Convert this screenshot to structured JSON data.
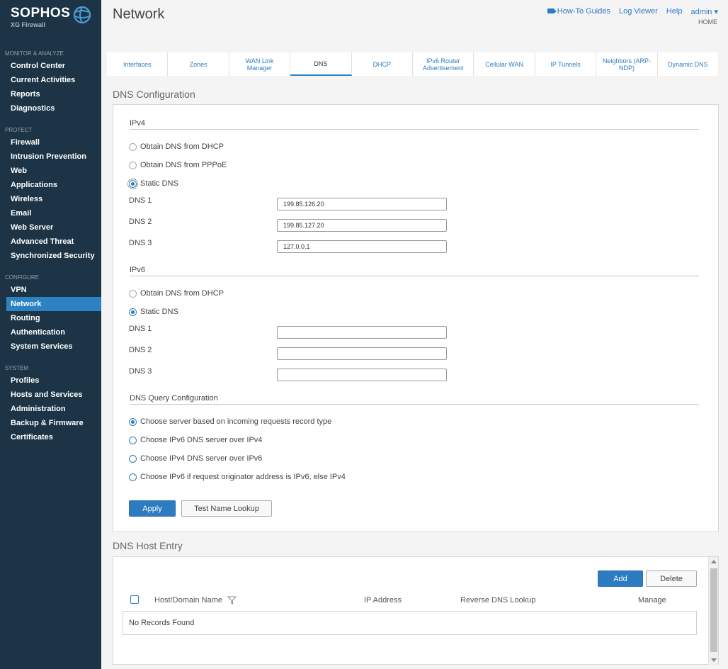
{
  "brand": {
    "name": "SOPHOS",
    "product": "XG Firewall"
  },
  "sidebar": {
    "sections": [
      {
        "label": "MONITOR & ANALYZE",
        "items": [
          "Control Center",
          "Current Activities",
          "Reports",
          "Diagnostics"
        ]
      },
      {
        "label": "PROTECT",
        "items": [
          "Firewall",
          "Intrusion Prevention",
          "Web",
          "Applications",
          "Wireless",
          "Email",
          "Web Server",
          "Advanced Threat",
          "Synchronized Security"
        ]
      },
      {
        "label": "CONFIGURE",
        "items": [
          "VPN",
          "Network",
          "Routing",
          "Authentication",
          "System Services"
        ]
      },
      {
        "label": "SYSTEM",
        "items": [
          "Profiles",
          "Hosts and Services",
          "Administration",
          "Backup & Firmware",
          "Certificates"
        ]
      }
    ],
    "active": "Network"
  },
  "header": {
    "title": "Network",
    "links": {
      "howto": "How-To Guides",
      "log": "Log Viewer",
      "help": "Help",
      "user": "admin ▾"
    },
    "home": "HOME"
  },
  "tabs": [
    "Interfaces",
    "Zones",
    "WAN Link Manager",
    "DNS",
    "DHCP",
    "IPv6 Router Advertisement",
    "Cellular WAN",
    "IP Tunnels",
    "Neighbors (ARP-NDP)",
    "Dynamic DNS"
  ],
  "active_tab": "DNS",
  "dns_config": {
    "title": "DNS Configuration",
    "ipv4": {
      "label": "IPv4",
      "options": [
        "Obtain DNS from DHCP",
        "Obtain DNS from PPPoE",
        "Static DNS"
      ],
      "selected": "Static DNS",
      "dns1_label": "DNS 1",
      "dns1": "199.85.126.20",
      "dns2_label": "DNS 2",
      "dns2": "199.85.127.20",
      "dns3_label": "DNS 3",
      "dns3": "127.0.0.1"
    },
    "ipv6": {
      "label": "IPv6",
      "options": [
        "Obtain DNS from DHCP",
        "Static DNS"
      ],
      "selected": "Static DNS",
      "dns1_label": "DNS 1",
      "dns1": "",
      "dns2_label": "DNS 2",
      "dns2": "",
      "dns3_label": "DNS 3",
      "dns3": ""
    },
    "query": {
      "label": "DNS Query Configuration",
      "options": [
        "Choose server based on incoming requests record type",
        "Choose IPv6 DNS server over IPv4",
        "Choose IPv4 DNS server over IPv6",
        "Choose IPv6 if request originator address is IPv6, else IPv4"
      ],
      "selected": "Choose server based on incoming requests record type"
    },
    "apply": "Apply",
    "test": "Test Name Lookup"
  },
  "host_entry": {
    "title": "DNS Host Entry",
    "add": "Add",
    "delete": "Delete",
    "columns": [
      "Host/Domain Name",
      "IP Address",
      "Reverse DNS Lookup",
      "Manage"
    ],
    "empty": "No Records Found"
  },
  "colors": {
    "sidebar": "#1c3446",
    "accent": "#2d7cc1",
    "active_nav": "#2d82c3"
  }
}
